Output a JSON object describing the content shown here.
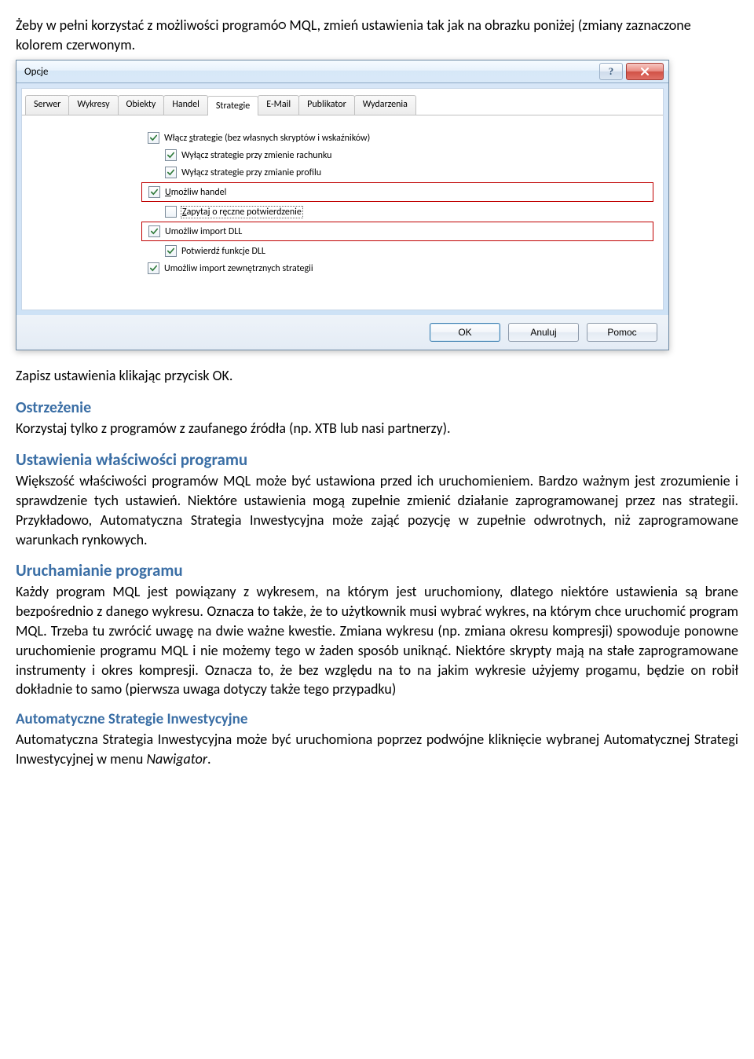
{
  "intro": {
    "line1": "Żeby w pełni korzystać z możliwości programó○ MQL, zmień ustawienia tak jak na obrazku poniżej (zmiany zaznaczone kolorem czerwonym."
  },
  "dialog": {
    "title": "Opcje",
    "tabs": {
      "serwer": "Serwer",
      "wykresy": "Wykresy",
      "obiekty": "Obiekty",
      "handel": "Handel",
      "strategie": "Strategie",
      "email": "E-Mail",
      "publikator": "Publikator",
      "wydarzenia": "Wydarzenia"
    },
    "checkboxes": {
      "c1_pre": "Włącz ",
      "c1_u": "s",
      "c1_post": "trategie (bez własnych skryptów i wskaźników)",
      "c2": "Wyłącz strategie przy zmienie rachunku",
      "c3": "Wyłącz strategie przy zmianie profilu",
      "c4_u": "U",
      "c4_post": "możliw handel",
      "c5_u": "Z",
      "c5_post": "apytaj o ręczne potwierdzenie",
      "c6": "Umożliw import DLL",
      "c7": "Potwierdź funkcje DLL",
      "c8": "Umożliw import zewnętrznych strategii"
    },
    "buttons": {
      "ok": "OK",
      "cancel": "Anuluj",
      "help": "Pomoc"
    }
  },
  "after_img": "Zapisz ustawienia klikając przycisk OK.",
  "warning": {
    "title": "Ostrzeżenie",
    "body": "Korzystaj tylko z programów z zaufanego źródła (np. XTB lub nasi partnerzy)."
  },
  "props": {
    "title": "Ustawienia właściwości programu",
    "body": "Większość właściwości programów MQL może być ustawiona przed ich uruchomieniem. Bardzo ważnym jest zrozumienie i sprawdzenie tych ustawień. Niektóre ustawienia mogą zupełnie zmienić działanie zaprogramowanej przez nas strategii. Przykładowo, Automatyczna Strategia Inwestycyjna może zająć pozycję w zupełnie odwrotnych, niż zaprogramowane warunkach rynkowych."
  },
  "launch": {
    "title": "Uruchamianie programu",
    "body": "Każdy program MQL jest powiązany z wykresem, na którym jest uruchomiony, dlatego niektóre ustawienia są brane bezpośrednio z danego wykresu. Oznacza to także, że to użytkownik musi wybrać wykres, na którym chce uruchomić program MQL. Trzeba tu zwrócić uwagę na dwie ważne kwestie. Zmiana wykresu (np. zmiana okresu kompresji) spowoduje ponowne uruchomienie programu MQL i nie możemy tego w żaden sposób uniknąć. Niektóre skrypty mają na stałe zaprogramowane instrumenty i okres kompresji. Oznacza to, że bez względu na to na jakim wykresie użyjemy progamu, będzie on robił dokładnie to samo (pierwsza uwaga dotyczy także tego przypadku)"
  },
  "asi": {
    "title": "Automatyczne Strategie Inwestycyjne",
    "body_pre": "Automatyczna Strategia Inwestycyjna może być uruchomiona poprzez podwójne kliknięcie wybranej Automatycznej Strategi Inwestycyjnej w menu ",
    "body_em": "Nawigator",
    "body_post": "."
  }
}
